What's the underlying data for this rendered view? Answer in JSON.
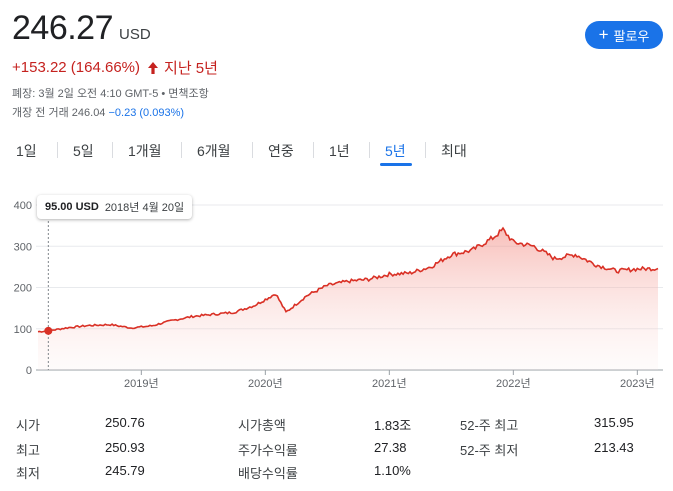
{
  "quote": {
    "price": "246.27",
    "currency": "USD",
    "change": "+153.22 (164.66%)",
    "period": "지난 5년",
    "close_info": "폐장: 3월 2일 오전 4:10 GMT-5 • 면책조항",
    "premarket_label": "개장 전 거래",
    "premarket_price": "246.04",
    "premarket_change": "−0.23 (0.093%)"
  },
  "follow_button": {
    "label": "팔로우",
    "icon": "plus-icon"
  },
  "tabs": [
    {
      "label": "1일",
      "active": false
    },
    {
      "label": "5일",
      "active": false
    },
    {
      "label": "1개월",
      "active": false
    },
    {
      "label": "6개월",
      "active": false
    },
    {
      "label": "연중",
      "active": false
    },
    {
      "label": "1년",
      "active": false
    },
    {
      "label": "5년",
      "active": true
    },
    {
      "label": "최대",
      "active": false
    }
  ],
  "tooltip": {
    "value": "95.00 USD",
    "date": "2018년 4월 20일"
  },
  "chart_data": {
    "type": "area",
    "yticks": [
      "0",
      "100",
      "200",
      "300",
      "400"
    ],
    "ylim": [
      0,
      400
    ],
    "xticks": [
      "2019년",
      "2020년",
      "2021년",
      "2022년",
      "2023년"
    ],
    "line_color": "#d93025",
    "x": [
      "2018-03",
      "2018-04",
      "2018-06",
      "2018-08",
      "2018-10",
      "2018-12",
      "2019-02",
      "2019-04",
      "2019-06",
      "2019-08",
      "2019-10",
      "2019-12",
      "2020-02",
      "2020-03",
      "2020-05",
      "2020-07",
      "2020-09",
      "2020-11",
      "2021-01",
      "2021-03",
      "2021-05",
      "2021-07",
      "2021-09",
      "2021-11",
      "2021-12",
      "2022-01",
      "2022-03",
      "2022-05",
      "2022-07",
      "2022-09",
      "2022-11",
      "2023-01",
      "2023-03"
    ],
    "values": [
      93,
      95,
      103,
      108,
      110,
      102,
      107,
      120,
      130,
      135,
      140,
      157,
      185,
      140,
      180,
      205,
      215,
      220,
      232,
      235,
      250,
      280,
      290,
      320,
      340,
      310,
      300,
      270,
      280,
      255,
      240,
      245,
      246
    ]
  },
  "stats": [
    {
      "label": "시가",
      "value": "250.76"
    },
    {
      "label": "최고",
      "value": "250.93"
    },
    {
      "label": "최저",
      "value": "245.79"
    },
    {
      "label": "시가총액",
      "value": "1.83조"
    },
    {
      "label": "주가수익률",
      "value": "27.38"
    },
    {
      "label": "배당수익률",
      "value": "1.10%"
    },
    {
      "label": "52-주 최고",
      "value": "315.95"
    },
    {
      "label": "52-주 최저",
      "value": "213.43"
    }
  ]
}
